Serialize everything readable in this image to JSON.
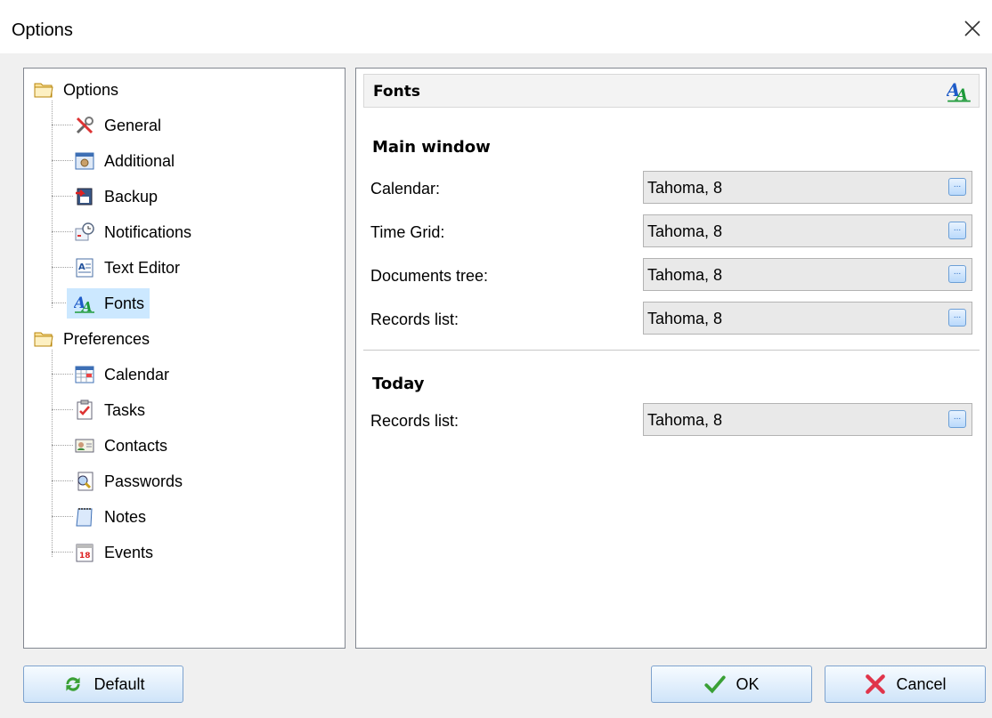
{
  "window": {
    "title": "Options"
  },
  "tree": {
    "groups": [
      {
        "label": "Options",
        "icon": "folder-icon",
        "items": [
          {
            "label": "General",
            "icon": "wrench-icon"
          },
          {
            "label": "Additional",
            "icon": "settings-window-icon"
          },
          {
            "label": "Backup",
            "icon": "backup-icon"
          },
          {
            "label": "Notifications",
            "icon": "notification-clock-icon"
          },
          {
            "label": "Text Editor",
            "icon": "text-editor-icon"
          },
          {
            "label": "Fonts",
            "icon": "fonts-icon",
            "selected": true
          }
        ]
      },
      {
        "label": "Preferences",
        "icon": "folder-icon",
        "items": [
          {
            "label": "Calendar",
            "icon": "calendar-icon"
          },
          {
            "label": "Tasks",
            "icon": "tasks-checklist-icon"
          },
          {
            "label": "Contacts",
            "icon": "contact-card-icon"
          },
          {
            "label": "Passwords",
            "icon": "passwords-magnifier-icon"
          },
          {
            "label": "Notes",
            "icon": "notepad-icon"
          },
          {
            "label": "Events",
            "icon": "calendar-date-18-icon"
          }
        ]
      }
    ]
  },
  "content": {
    "header": "Fonts",
    "sections": [
      {
        "title": "Main window",
        "rows": [
          {
            "label": "Calendar:",
            "value": "Tahoma, 8",
            "button": "..."
          },
          {
            "label": "Time Grid:",
            "value": "Tahoma, 8",
            "button": "..."
          },
          {
            "label": "Documents tree:",
            "value": "Tahoma, 8",
            "button": "..."
          },
          {
            "label": "Records list:",
            "value": "Tahoma, 8",
            "button": "..."
          }
        ]
      },
      {
        "title": "Today",
        "rows": [
          {
            "label": "Records list:",
            "value": "Tahoma, 8",
            "button": "..."
          }
        ]
      }
    ]
  },
  "buttons": {
    "default": "Default",
    "ok": "OK",
    "cancel": "Cancel"
  },
  "colors": {
    "selection": "#cce8ff",
    "button_border": "#7da2ce",
    "ok_check": "#3aa035",
    "cancel_x": "#e0344a",
    "font_icon_blue": "#1e5bc8",
    "font_icon_green": "#1e9a3a"
  }
}
